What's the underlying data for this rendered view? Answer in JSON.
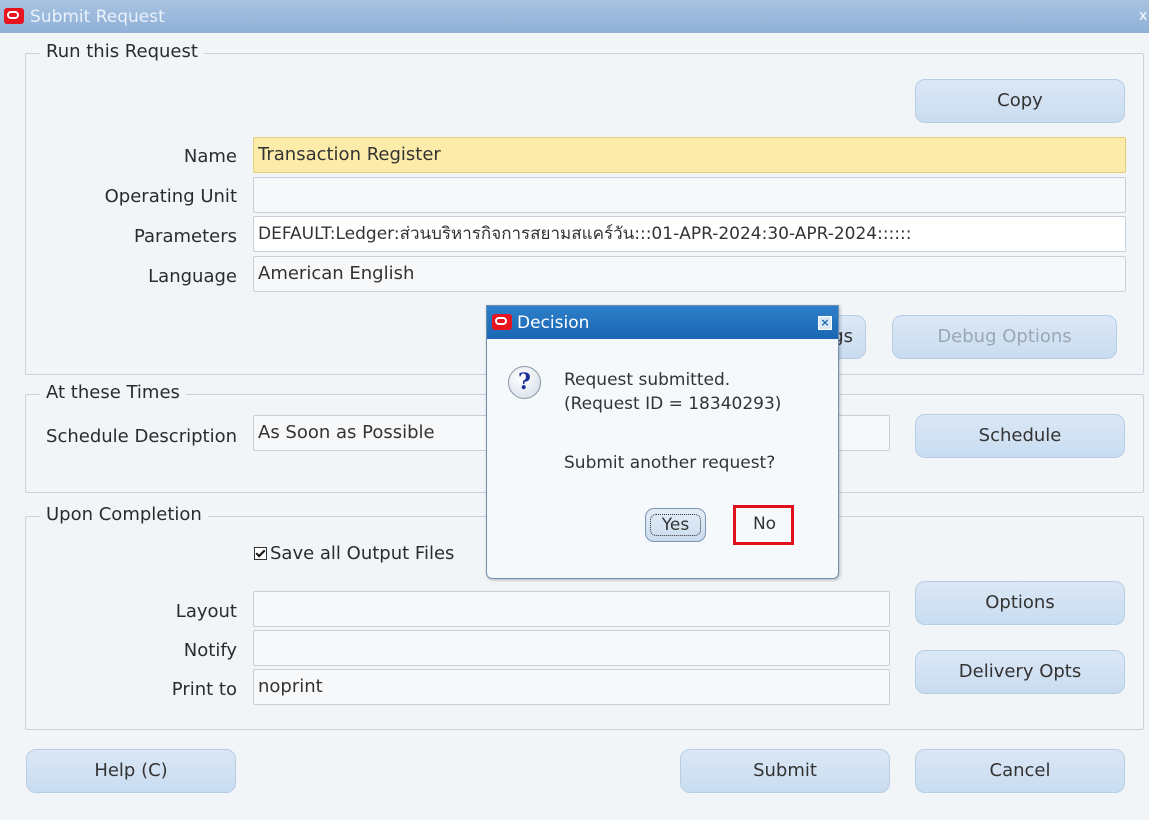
{
  "window": {
    "title": "Submit Request",
    "close_glyph": "x"
  },
  "run_group": {
    "legend": "Run this Request",
    "copy_button": "Copy",
    "copy_mnemonic": "p",
    "name_label": "Name",
    "name_value": "Transaction Register",
    "operating_unit_label": "Operating Unit",
    "operating_unit_value": "",
    "parameters_label": "Parameters",
    "parameters_value": "DEFAULT:Ledger:ส่วนบริหารกิจการสยามสแคร์วัน:::01-APR-2024:30-APR-2024::::::",
    "language_label": "Language",
    "language_value": "American English",
    "language_settings_partial": "gs",
    "debug_button": "Debug Options"
  },
  "times_group": {
    "legend": "At these Times",
    "schedule_desc_label": "Schedule Description",
    "schedule_desc_value": "As Soon as Possible",
    "schedule_button": "Schedule"
  },
  "completion_group": {
    "legend": "Upon Completion",
    "save_output_label": "Save all Output Files",
    "save_output_checked": true,
    "layout_label": "Layout",
    "layout_value": "",
    "notify_label": "Notify",
    "notify_value": "",
    "print_to_label": "Print to",
    "print_to_value": "noprint",
    "options_button": "Options",
    "delivery_button": "Delivery Opts"
  },
  "footer": {
    "help_button": "Help (C)",
    "submit_button": "Submit",
    "cancel_button": "Cancel"
  },
  "dialog": {
    "title": "Decision",
    "message_line1": "Request submitted.",
    "message_line2": "(Request ID = 18340293)",
    "question": "Submit another request?",
    "yes_button": "Yes",
    "no_button": "No",
    "highlighted": "no_button",
    "highlight_color": "#e0101c"
  },
  "colors": {
    "required_field": "#fdebaa",
    "button_face": "#c9dcf0",
    "dialog_title": "#1a66b3",
    "oracle_red": "#e8141f"
  }
}
